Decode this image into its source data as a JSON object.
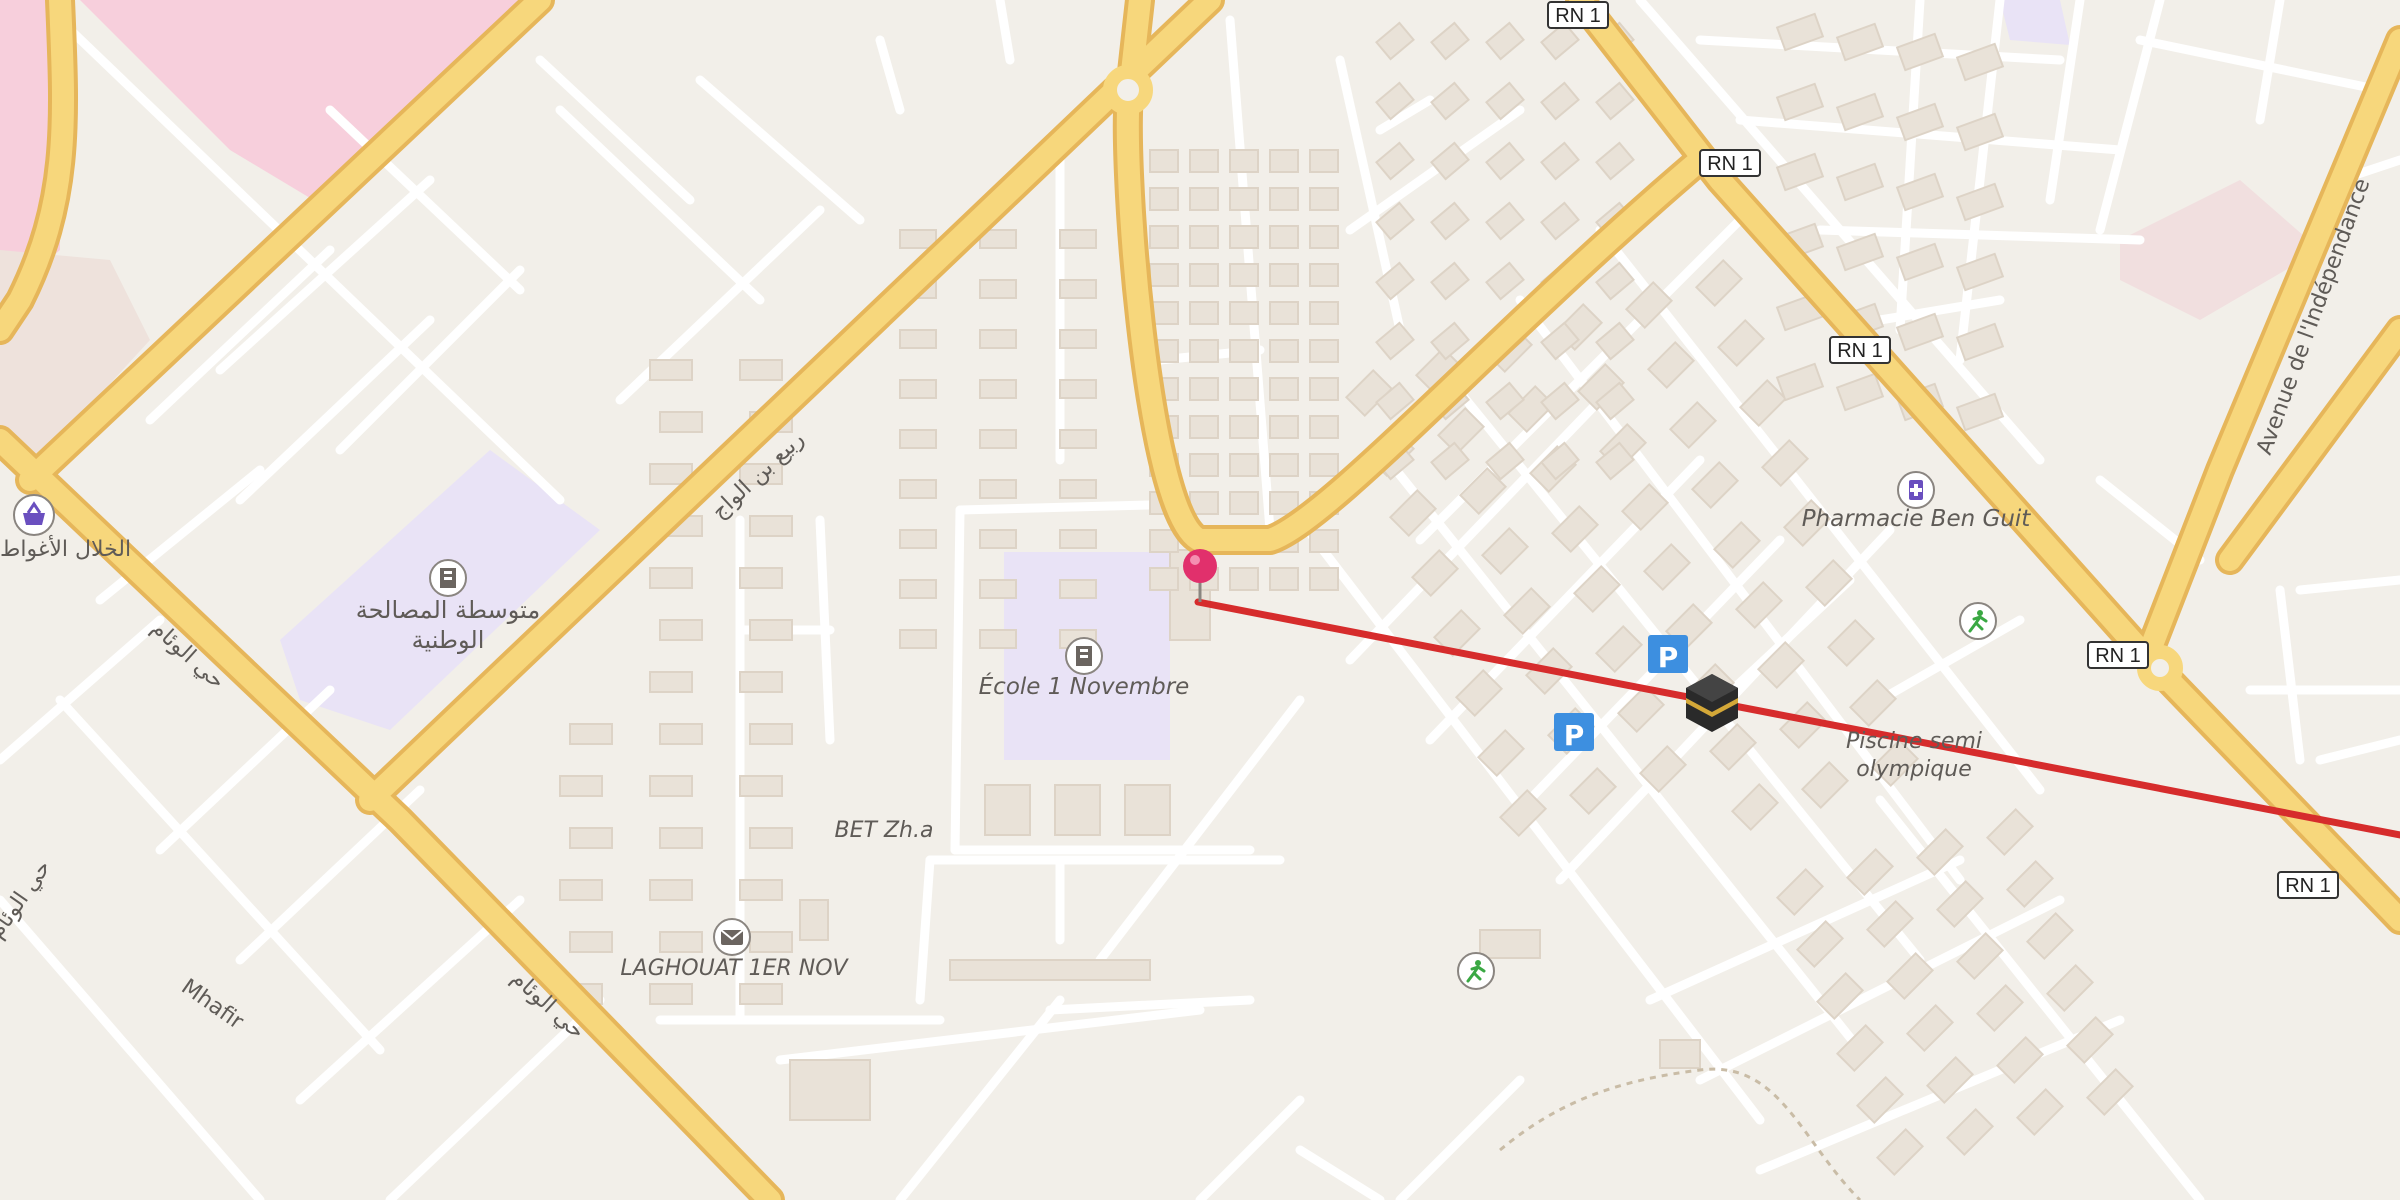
{
  "map": {
    "colors": {
      "background": "#f2efe9",
      "major_road_fill": "#f7d77c",
      "major_road_casing": "#e6b65a",
      "minor_road": "#ffffff",
      "building": "#e9e2d8",
      "building_edge": "#ddd3c6",
      "school_area": "#e9e3f6",
      "commercial_area": "#f7cfdc",
      "route_line": "#d62c2c",
      "pin": "#e1306c",
      "parking": "#3d8fe0"
    },
    "road_shields": [
      "RN 1",
      "RN 1",
      "RN 1",
      "RN 1",
      "RN 1"
    ],
    "labels": {
      "school_ar": "متوسطة المصالحة الوطنية",
      "school_ar_line1": "متوسطة المصالحة",
      "school_ar_line2": "الوطنية",
      "ecole": "École 1 Novembre",
      "pharmacy": "Pharmacie Ben Guit",
      "piscine_line1": "Piscine semi",
      "piscine_line2": "olympique",
      "bet": "BET Zh.a",
      "post_office": "LAGHOUAT 1ER NOV",
      "mhafir": "Mhafir",
      "avenue": "Avenue de l'Indépendance",
      "market_ar": "الخلال الأغواط",
      "street_ar_1": "حي الوئام",
      "street_ar_2": "حي الوئام",
      "street_ar_3": "ربيع بن الواج",
      "street_ar_4": "حي الوئام"
    },
    "icons": [
      "school-icon",
      "school-icon",
      "shopping-basket-icon",
      "pharmacy-icon",
      "sports-icon",
      "sports-icon",
      "parking-icon",
      "parking-icon",
      "post-office-icon",
      "kaaba-icon",
      "location-pin-icon"
    ]
  }
}
